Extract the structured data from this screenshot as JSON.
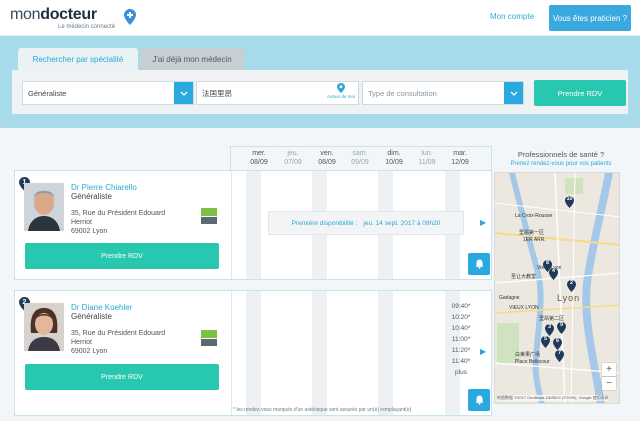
{
  "header": {
    "logo_light": "mon",
    "logo_bold": "docteur",
    "logo_tagline": "Le médecin connecté",
    "account_link": "Mon compte",
    "pro_button": "Vous êtes praticien ?"
  },
  "search": {
    "tabs": [
      "Rechercher par spécialité",
      "J'ai déjà mon médecin"
    ],
    "specialty_value": "Généraliste",
    "location_value": "法国里昂",
    "geo_label": "Autour de moi",
    "consultation_placeholder": "Type de consultation",
    "submit_label": "Prendre RDV"
  },
  "calendar": {
    "days": [
      {
        "name": "mer.",
        "date": "08/09"
      },
      {
        "name": "jeu.",
        "date": "07/09"
      },
      {
        "name": "ven.",
        "date": "08/09"
      },
      {
        "name": "sam.",
        "date": "09/09"
      },
      {
        "name": "dim.",
        "date": "10/09"
      },
      {
        "name": "lun.",
        "date": "11/09"
      },
      {
        "name": "mar.",
        "date": "12/09"
      }
    ]
  },
  "doctors": [
    {
      "index": "1",
      "name": "Dr Pierre Chiarello",
      "specialty": "Généraliste",
      "address_line1": "35, Rue du Président Edouard",
      "address_line2": "Herriot",
      "address_line3": "69002 Lyon",
      "rdv_label": "Prendre RDV",
      "first_dispo_label": "Première disponibilité :",
      "first_dispo_date": "jeu. 14 sept. 2017 à 09h20"
    },
    {
      "index": "2",
      "name": "Dr Diane Koehler",
      "specialty": "Généraliste",
      "address_line1": "35, Rue du Président Edouard",
      "address_line2": "Herriot",
      "address_line3": "69002 Lyon",
      "rdv_label": "Prendre RDV",
      "times": [
        "09:40*",
        "10:20*",
        "10:40*",
        "11:00*",
        "11:20*",
        "11:40*",
        "plus"
      ]
    }
  ],
  "footnote": "* les rendez-vous marqués d'un astérisque sont assurés par un(e) remplaçant(e)",
  "sidebar": {
    "title": "Professionnels de santé ?",
    "link": "Prenez rendez-vous pour vos patients"
  },
  "map": {
    "labels": [
      "La Croix-Rousse",
      "里昂第一区",
      "1ER ARR.",
      "圣让大教堂",
      "Vieux Lyon",
      "Gadagne",
      "VIEUX LYON",
      "里昂第二区",
      "Place Bellecour",
      "白莱果广场",
      "Lyon"
    ],
    "pins": [
      "10",
      "8",
      "4",
      "2",
      "3",
      "6",
      "5",
      "7",
      "9"
    ],
    "zoom_in": "+",
    "zoom_out": "−",
    "copyright": "地图数据 ©2017 GeoBasis-DE/BKG (©2009), Google 使用条款"
  },
  "colors": {
    "accent_blue": "#2aa8d3",
    "teal": "#27c7b0",
    "band": "#a8dbe9",
    "pin_navy": "#1f3a5a"
  }
}
